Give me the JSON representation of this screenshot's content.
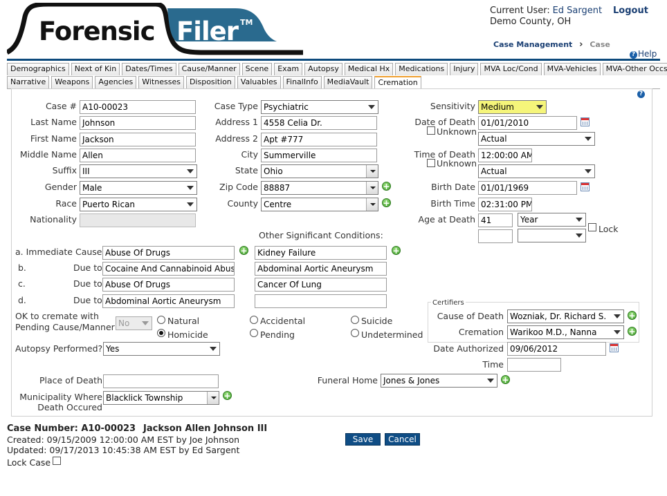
{
  "header": {
    "logo_left": "Forensic",
    "logo_right": "Filer",
    "logo_tm": "TM",
    "current_user_label": "Current User:",
    "current_user_name": "Ed Sargent",
    "logout": "Logout",
    "county": "Demo County, OH",
    "breadcrumb_1": "Case Management",
    "breadcrumb_sep": "›",
    "breadcrumb_2": "Case",
    "help": "Help"
  },
  "tabs_row1": [
    "Demographics",
    "Next of Kin",
    "Dates/Times",
    "Cause/Manner",
    "Scene",
    "Exam",
    "Autopsy",
    "Medical Hx",
    "Medications",
    "Injury",
    "MVA Loc/Cond",
    "MVA-Vehicles",
    "MVA-Other Occs"
  ],
  "tabs_row2": [
    "Narrative",
    "Weapons",
    "Agencies",
    "Witnesses",
    "Disposition",
    "Valuables",
    "FinalInfo",
    "MediaVault",
    "Cremation"
  ],
  "active_tab": "Cremation",
  "form": {
    "case_no_label": "Case #",
    "case_no": "A10-00023",
    "last_name_label": "Last Name",
    "last_name": "Johnson",
    "first_name_label": "First Name",
    "first_name": "Jackson",
    "middle_name_label": "Middle Name",
    "middle_name": "Allen",
    "suffix_label": "Suffix",
    "suffix": "III",
    "gender_label": "Gender",
    "gender": "Male",
    "race_label": "Race",
    "race": "Puerto Rican",
    "nationality_label": "Nationality",
    "nationality": "",
    "case_type_label": "Case Type",
    "case_type": "Psychiatric",
    "address1_label": "Address 1",
    "address1": "4558 Celia Dr.",
    "address2_label": "Address 2",
    "address2": "Apt #777",
    "city_label": "City",
    "city": "Summerville",
    "state_label": "State",
    "state": "Ohio",
    "zip_label": "Zip Code",
    "zip": "88887",
    "county_label": "County",
    "county": "Centre",
    "sensitivity_label": "Sensitivity",
    "sensitivity": "Medium",
    "dod_label": "Date of Death",
    "dod": "01/01/2010",
    "dod_unknown": "Unknown",
    "dod_type": "Actual",
    "tod_label": "Time of Death",
    "tod": "12:00:00 AM",
    "tod_unknown": "Unknown",
    "tod_type": "Actual",
    "birth_date_label": "Birth Date",
    "birth_date": "01/01/1969",
    "birth_time_label": "Birth Time",
    "birth_time": "02:31:00 PM",
    "age_label": "Age at Death",
    "age": "41",
    "age_unit": "Year",
    "age2": "",
    "age_unit2": "",
    "lock_label": "Lock",
    "other_conditions_label": "Other Significant Conditions:",
    "cause_a_label": "a. Immediate Cause",
    "cause_a": "Abuse Of Drugs",
    "cause_b_prefix": "b.",
    "cause_b_label": "Due to",
    "cause_b": "Cocaine And Cannabinoid Abuse",
    "cause_c_prefix": "c.",
    "cause_c_label": "Due to",
    "cause_c": "Abuse Of Drugs",
    "cause_d_prefix": "d.",
    "cause_d_label": "Due to",
    "cause_d": "Abdominal Aortic Aneurysm",
    "other_1": "Kidney Failure",
    "other_2": "Abdominal Aortic Aneurysm",
    "other_3": "Cancer Of Lung",
    "other_4": "",
    "ok_cremate_label_1": "OK to cremate with",
    "ok_cremate_label_2": "Pending Cause/Manner",
    "ok_cremate": "No",
    "manner_natural": "Natural",
    "manner_accidental": "Accidental",
    "manner_suicide": "Suicide",
    "manner_homicide": "Homicide",
    "manner_pending": "Pending",
    "manner_undetermined": "Undetermined",
    "manner_selected": "Homicide",
    "autopsy_label": "Autopsy Performed?",
    "autopsy": "Yes",
    "certifiers_title": "Certifiers",
    "cert_cod_label": "Cause of Death",
    "cert_cod": "Wozniak, Dr. Richard S.",
    "cert_crem_label": "Cremation",
    "cert_crem": "Warikoo M.D., Nanna",
    "date_auth_label": "Date Authorized",
    "date_auth": "09/06/2012",
    "time_label": "Time",
    "time": "",
    "place_label": "Place of Death",
    "place": "",
    "funeral_label": "Funeral Home",
    "funeral": "Jones & Jones",
    "municipality_label_1": "Municipality Where",
    "municipality_label_2": "Death Occured",
    "municipality": "Blacklick Township"
  },
  "footer": {
    "case_number": "Case Number: A10-00023",
    "case_name": "Jackson Allen Johnson III",
    "created": "Created: 09/15/2009 12:00:00 AM EST by Joe Johnson",
    "updated": "Updated: 09/17/2013 10:45:38 AM EST by Ed Sargent",
    "lock_case": "Lock Case",
    "save": "Save",
    "cancel": "Cancel"
  },
  "colors": {
    "brand_navy": "#0d4a7c",
    "highlight": "#f5f57a",
    "tab_active_accent": "#f0a030"
  }
}
